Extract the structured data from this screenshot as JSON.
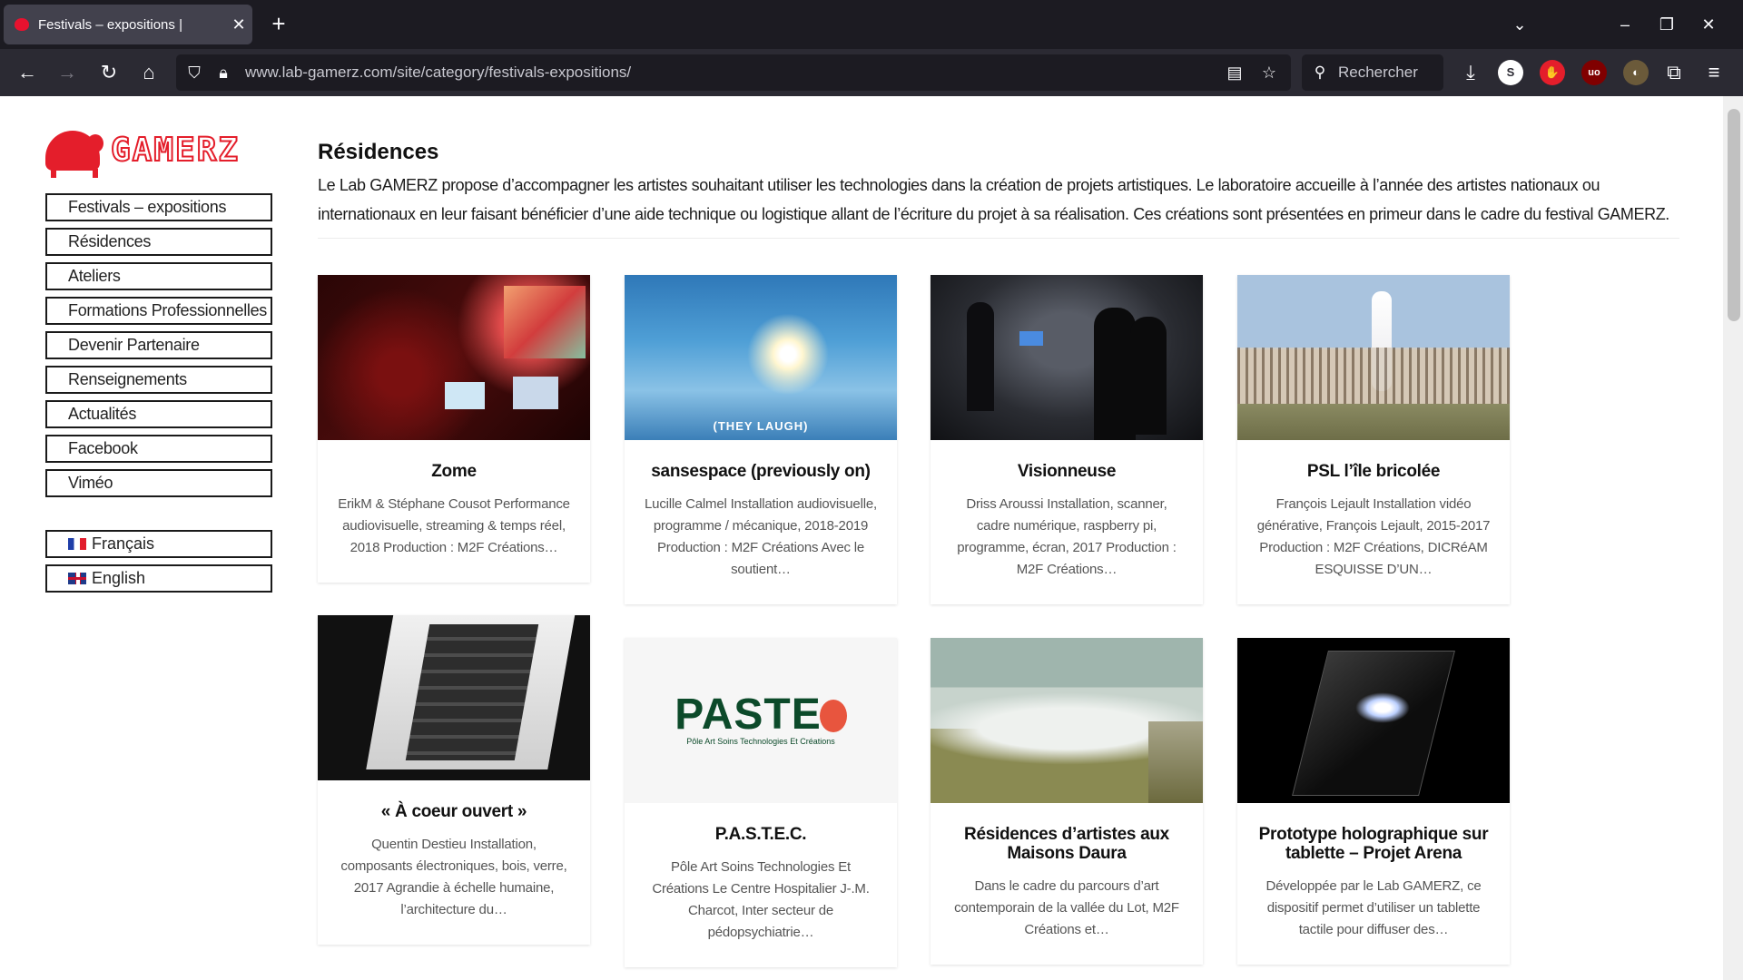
{
  "browser": {
    "tab_title": "Festivals – expositions |",
    "tab_close": "✕",
    "new_tab": "+",
    "url": "www.lab-gamerz.com/site/category/festivals-expositions/",
    "search_placeholder": "Rechercher",
    "colors": {
      "tabbar": "#1c1b22",
      "navbar": "#2b2a33",
      "tab_active": "#42414d"
    }
  },
  "site": {
    "logo_text": "GAMERZ",
    "accent": "#e41e2b",
    "menu": [
      "Festivals – expositions",
      "Résidences",
      "Ateliers",
      "Formations Professionnelles",
      "Devenir Partenaire",
      "Renseignements",
      "Actualités",
      "Facebook",
      "Viméo"
    ],
    "languages": [
      {
        "label": "Français",
        "flag": "flag-fr"
      },
      {
        "label": "English",
        "flag": "flag-en"
      }
    ]
  },
  "main": {
    "heading": "Résidences",
    "intro": "Le Lab GAMERZ propose d’accompagner les artistes souhaitant utiliser les technologies dans la création de projets artistiques. Le laboratoire accueille à l’année des artistes nationaux ou internationaux en leur faisant bénéficier d’une aide technique ou logistique allant de l’écriture du projet à sa réalisation. Ces créations sont présentées en primeur dans le cadre du festival GAMERZ.",
    "cards": [
      {
        "title": "Zome",
        "desc": "ErikM & Stéphane Cousot Performance audiovisuelle, streaming & temps réel, 2018 Production : M2F Créations…"
      },
      {
        "title": "sansespace (previously on)",
        "desc": "Lucille Calmel Installation audiovisuelle, programme / mécanique, 2018-2019 Production : M2F Créations Avec le soutient…",
        "image_caption": "(THEY LAUGH)"
      },
      {
        "title": "Visionneuse",
        "desc": "Driss Aroussi Installation, scanner, cadre numérique, raspberry pi, programme, écran, 2017 Production : M2F Créations…"
      },
      {
        "title": "PSL l’île bricolée",
        "desc": "François Lejault Installation vidéo générative, François Lejault, 2015-2017 Production : M2F Créations, DICRéAM ESQUISSE D’UN…"
      },
      {
        "title": "« À coeur ouvert »",
        "desc": "Quentin Destieu Installation, composants électroniques, bois, verre, 2017 Agrandie à échelle humaine, l’architecture du…"
      },
      {
        "title": "P.A.S.T.E.C.",
        "desc": "Pôle Art Soins Technologies Et Créations Le Centre Hospitalier J-.M. Charcot, Inter secteur de pédopsychiatrie…",
        "logo_text": "PASTE",
        "logo_sub": "Pôle Art Soins Technologies Et Créations"
      },
      {
        "title": "Résidences d’artistes aux Maisons Daura",
        "desc": "Dans le cadre du parcours d’art contemporain de la vallée du Lot, M2F Créations et…"
      },
      {
        "title": "Prototype holographique sur tablette – Projet Arena",
        "desc": "Développée par le Lab GAMERZ, ce dispositif permet d’utiliser un tablette tactile pour diffuser des…"
      }
    ]
  }
}
